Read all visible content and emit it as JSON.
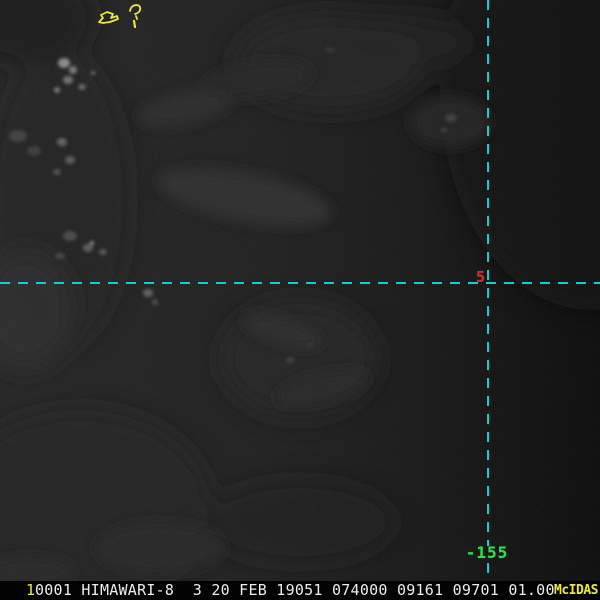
{
  "grid": {
    "line_color": "#12cfcf",
    "latitude_label": {
      "text": "5",
      "color": "#d23030"
    },
    "longitude_label": {
      "text": "-155",
      "color": "#2ede52"
    }
  },
  "map_overlay": {
    "color": "#e9e93c"
  },
  "status_bar": {
    "background": "#030303",
    "frame_number": {
      "text": "1",
      "color": "#eaea3e"
    },
    "info_text": "0001 HIMAWARI-8  3 20 FEB 19051 074000 09161 09701 01.00",
    "info_color": "#ededed",
    "brand": {
      "text": "McIDAS",
      "color": "#eaea3e"
    }
  }
}
